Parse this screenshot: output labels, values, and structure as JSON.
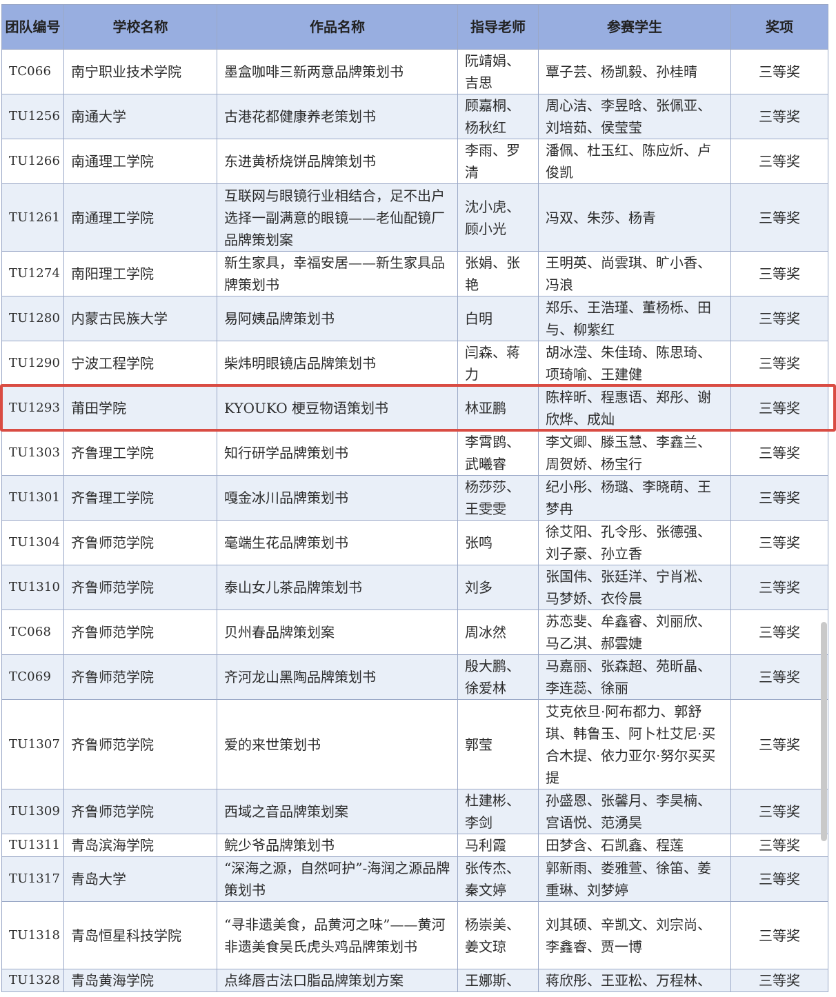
{
  "headers": [
    "团队编号",
    "学校名称",
    "作品名称",
    "指导老师",
    "参赛学生",
    "奖项"
  ],
  "rows": [
    {
      "id": "TC066",
      "school": "南宁职业技术学院",
      "work": "墨盒咖啡三新两意品牌策划书",
      "teacher": "阮靖娟、吉思",
      "students": "覃子芸、杨凯毅、孙桂晴",
      "award": "三等奖"
    },
    {
      "id": "TU1256",
      "school": "南通大学",
      "work": "古港花都健康养老策划书",
      "teacher": "顾嘉桐、杨秋红",
      "students": "周心洁、李昱晗、张佩亚、刘培茹、侯莹莹",
      "award": "三等奖"
    },
    {
      "id": "TU1266",
      "school": "南通理工学院",
      "work": "东进黄桥烧饼品牌策划书",
      "teacher": "李雨、罗清",
      "students": "潘佩、杜玉红、陈应炘、卢俊凯",
      "award": "三等奖"
    },
    {
      "id": "TU1261",
      "school": "南通理工学院",
      "work": "互联网与眼镜行业相结合，足不出户选择一副满意的眼镜——老仙配镜厂品牌策划案",
      "teacher": "沈小虎、顾小光",
      "students": "冯双、朱莎、杨青",
      "award": "三等奖"
    },
    {
      "id": "TU1274",
      "school": "南阳理工学院",
      "work": "新生家具，幸福安居——新生家具品牌策划书",
      "teacher": "张娟、张艳",
      "students": "王明英、尚雲琪、旷小香、冯浪",
      "award": "三等奖"
    },
    {
      "id": "TU1280",
      "school": "内蒙古民族大学",
      "work": "易阿姨品牌策划书",
      "teacher": "白明",
      "students": "郑乐、王浩瑾、董杨栎、田与、柳紫红",
      "award": "三等奖"
    },
    {
      "id": "TU1290",
      "school": "宁波工程学院",
      "work": "柴炜明眼镜店品牌策划书",
      "teacher": "闫森、蒋力",
      "students": "胡冰滢、朱佳琦、陈思琦、项琦喻、王建健",
      "award": "三等奖"
    },
    {
      "id": "TU1293",
      "school": "莆田学院",
      "work": "KYOUKO 梗豆物语策划书",
      "teacher": "林亚鹏",
      "students": "陈梓昕、程惠语、郑彤、谢欣烨、成灿",
      "award": "三等奖"
    },
    {
      "id": "TU1303",
      "school": "齐鲁理工学院",
      "work": "知行研学品牌策划书",
      "teacher": "李霄鹍、武曦睿",
      "students": "李文卿、滕玉慧、李鑫兰、周贺娇、杨宝行",
      "award": "三等奖"
    },
    {
      "id": "TU1301",
      "school": "齐鲁理工学院",
      "work": "嘎金冰川品牌策划书",
      "teacher": "杨莎莎、王雯雯",
      "students": "纪小彤、杨璐、李晓萌、王梦冉",
      "award": "三等奖"
    },
    {
      "id": "TU1304",
      "school": "齐鲁师范学院",
      "work": "毫端生花品牌策划书",
      "teacher": "张鸣",
      "students": "徐艾阳、孔令彤、张德强、刘子豪、孙立香",
      "award": "三等奖"
    },
    {
      "id": "TU1310",
      "school": "齐鲁师范学院",
      "work": "泰山女儿茶品牌策划书",
      "teacher": "刘多",
      "students": "张国伟、张廷洋、宁肖凇、马梦娇、衣伶晨",
      "award": "三等奖"
    },
    {
      "id": "TC068",
      "school": "齐鲁师范学院",
      "work": "贝州春品牌策划案",
      "teacher": "周冰然",
      "students": "苏恋斐、牟鑫睿、刘丽欣、马乙淇、郝雲婕",
      "award": "三等奖"
    },
    {
      "id": "TC069",
      "school": "齐鲁师范学院",
      "work": "齐河龙山黑陶品牌策划书",
      "teacher": "殷大鹏、徐爱林",
      "students": "马嘉丽、张森超、苑昕晶、李连蕊、徐丽",
      "award": "三等奖"
    },
    {
      "id": "TU1307",
      "school": "齐鲁师范学院",
      "work": "爱的来世策划书",
      "teacher": "郭莹",
      "students": "艾克依旦·阿布都力、郭舒琪、韩鲁玉、阿卜杜艾尼·买合木提、依力亚尔·努尔买买提",
      "award": "三等奖"
    },
    {
      "id": "TU1309",
      "school": "齐鲁师范学院",
      "work": "西域之音品牌策划案",
      "teacher": "杜建彬、李剑",
      "students": "孙盛恩、张馨月、李昊楠、宫语悦、范湧昊",
      "award": "三等奖"
    },
    {
      "id": "TU1311",
      "school": "青岛滨海学院",
      "work": "鲩少爷品牌策划书",
      "teacher": "马利霞",
      "students": "田梦含、石凯鑫、程莲",
      "award": "三等奖"
    },
    {
      "id": "TU1317",
      "school": "青岛大学",
      "work": "“深海之源，自然呵护”-海润之源品牌策划书",
      "teacher": "张传杰、秦文婷",
      "students": "郭新雨、娄雅萱、徐笛、姜重琳、刘梦婷",
      "award": "三等奖"
    },
    {
      "id": "TU1318",
      "school": "青岛恒星科技学院",
      "work": "“寻非遗美食，品黄河之味”——黄河非遗美食吴氏虎头鸡品牌策划书",
      "teacher": "杨崇美、姜文琼",
      "students": "刘其硕、辛凯文、刘宗尚、李鑫睿、贾一博",
      "award": "三等奖"
    },
    {
      "id": "TU1328",
      "school": "青岛黄海学院",
      "work": "点绛唇古法口脂品牌策划方案",
      "teacher": "王娜斯、",
      "students": "蒋欣彤、王亚松、万程林、",
      "award": "三等奖"
    }
  ]
}
